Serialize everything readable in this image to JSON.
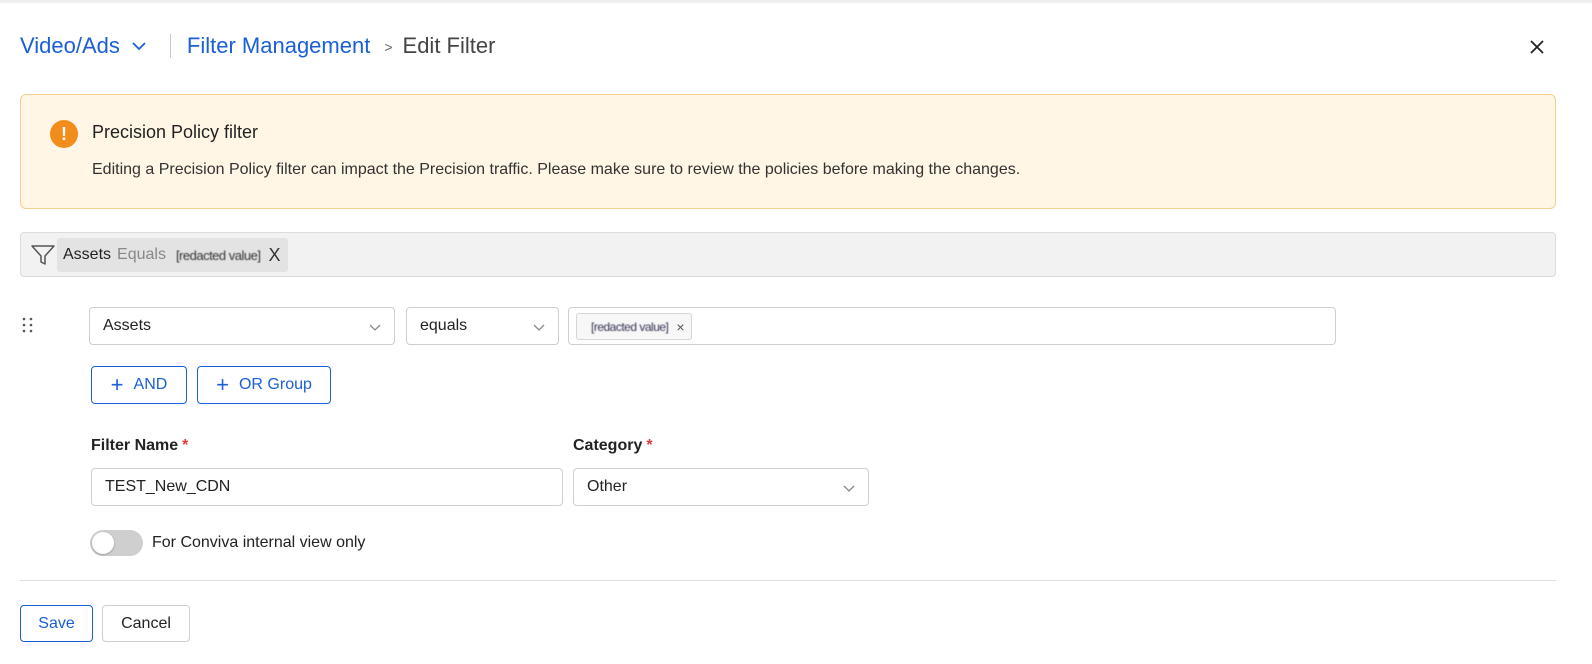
{
  "header": {
    "app_switcher": "Video/Ads",
    "breadcrumb_link": "Filter Management",
    "breadcrumb_separator": ">",
    "current_page": "Edit Filter"
  },
  "banner": {
    "title": "Precision Policy filter",
    "message": "Editing a Precision Policy filter can impact the Precision traffic. Please make sure to review the policies before making the changes.",
    "icon": "exclamation-icon",
    "icon_glyph": "!",
    "accent_color": "#f28c1b"
  },
  "summary": {
    "field": "Assets",
    "operator": "Equals",
    "value": "[redacted value]",
    "remove_glyph": "X"
  },
  "condition": {
    "field": "Assets",
    "operator": "equals",
    "value_chip": "[redacted value]",
    "remove_glyph": "×"
  },
  "actions": {
    "add_and": "AND",
    "add_or_group": "OR Group",
    "plus_glyph": "+"
  },
  "form": {
    "filter_name_label": "Filter Name",
    "filter_name_value": "TEST_New_CDN",
    "category_label": "Category",
    "category_value": "Other",
    "required_mark": "*",
    "internal_toggle_label": "For Conviva internal view only",
    "internal_toggle_on": false
  },
  "footer": {
    "save": "Save",
    "cancel": "Cancel"
  },
  "colors": {
    "link": "#1a5fd6",
    "warning_bg": "#fff6e5",
    "warning_border": "#f5cf8e",
    "required": "#e23b3b"
  }
}
